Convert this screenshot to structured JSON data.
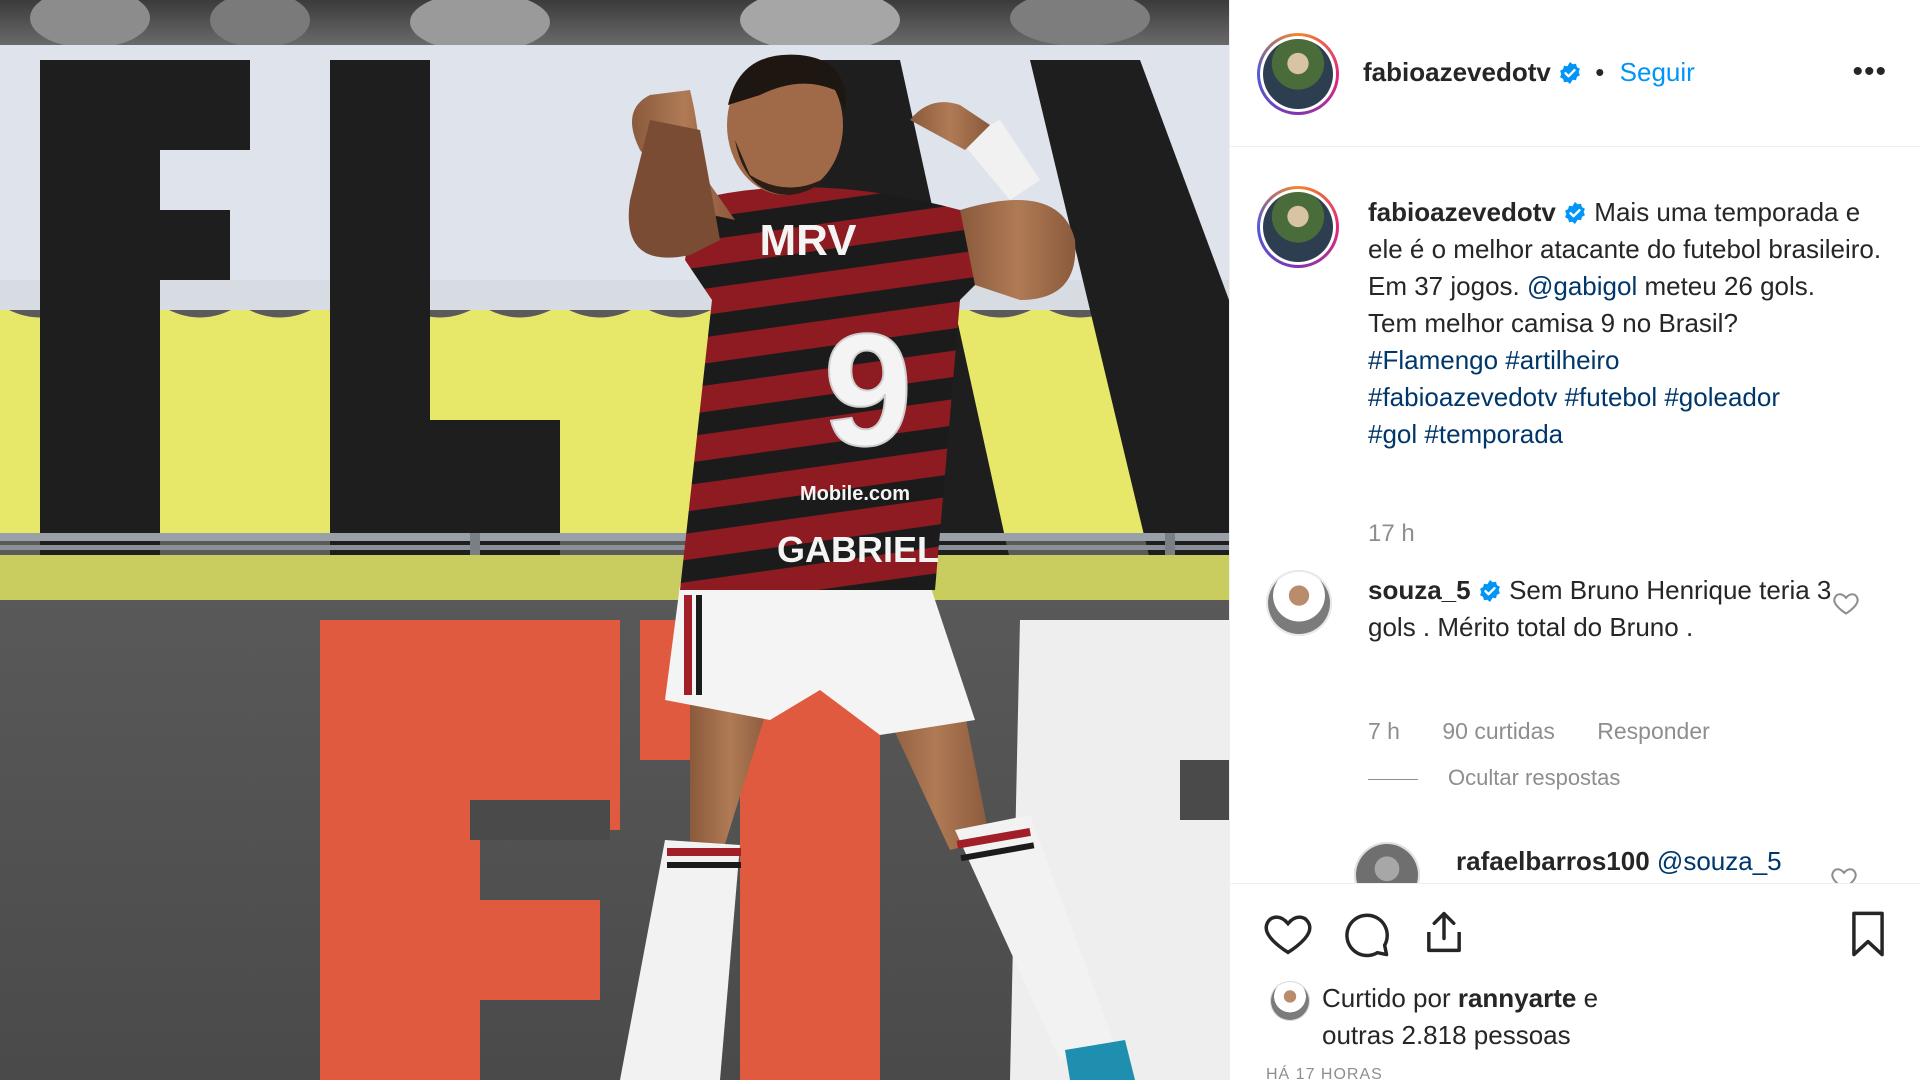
{
  "post": {
    "author": "fabioazevedotv",
    "follow_label": "Seguir",
    "dot": "•",
    "more_label": "•••"
  },
  "caption": {
    "author": "fabioazevedotv",
    "text_1": "Mais uma temporada e ele é o melhor atacante do futebol brasileiro.",
    "text_2_pre": "Em 37 jogos. ",
    "mention": "@gabigol",
    "text_2_post": " meteu 26 gols.",
    "text_3": "Tem melhor camisa 9 no Brasil?",
    "hashtags_line_1": "#Flamengo #artilheiro",
    "hashtags_line_2": "#fabioazevedotv #futebol #goleador",
    "hashtags_line_3": "#gol #temporada",
    "time": "17 h"
  },
  "comment": {
    "author": "souza_5",
    "text": "Sem Bruno Henrique teria 3 gols . Mérito total do Bruno .",
    "time": "7 h",
    "likes": "90 curtidas",
    "reply_label": "Responder",
    "hide_replies_label": "Ocultar respostas"
  },
  "reply": {
    "author": "rafaelbarros100",
    "mention": "@souza_5"
  },
  "likes": {
    "prefix": "Curtido por ",
    "user": "rannyarte",
    "middle": " e",
    "rest": "outras 2.818 pessoas"
  },
  "date": "HÁ 17 HORAS",
  "photo": {
    "jersey_sponsor": "MRV",
    "jersey_number": "9",
    "jersey_name": "GABRIEL",
    "jersey_front_sponsor": "Mobile.com",
    "banner_text": "FLA",
    "board_text": "FO"
  },
  "colors": {
    "verified": "#0095f6",
    "link": "#00376b",
    "muted": "#8e8e8e",
    "jersey_red": "#8e1b22",
    "jersey_black": "#1b1b1b"
  }
}
